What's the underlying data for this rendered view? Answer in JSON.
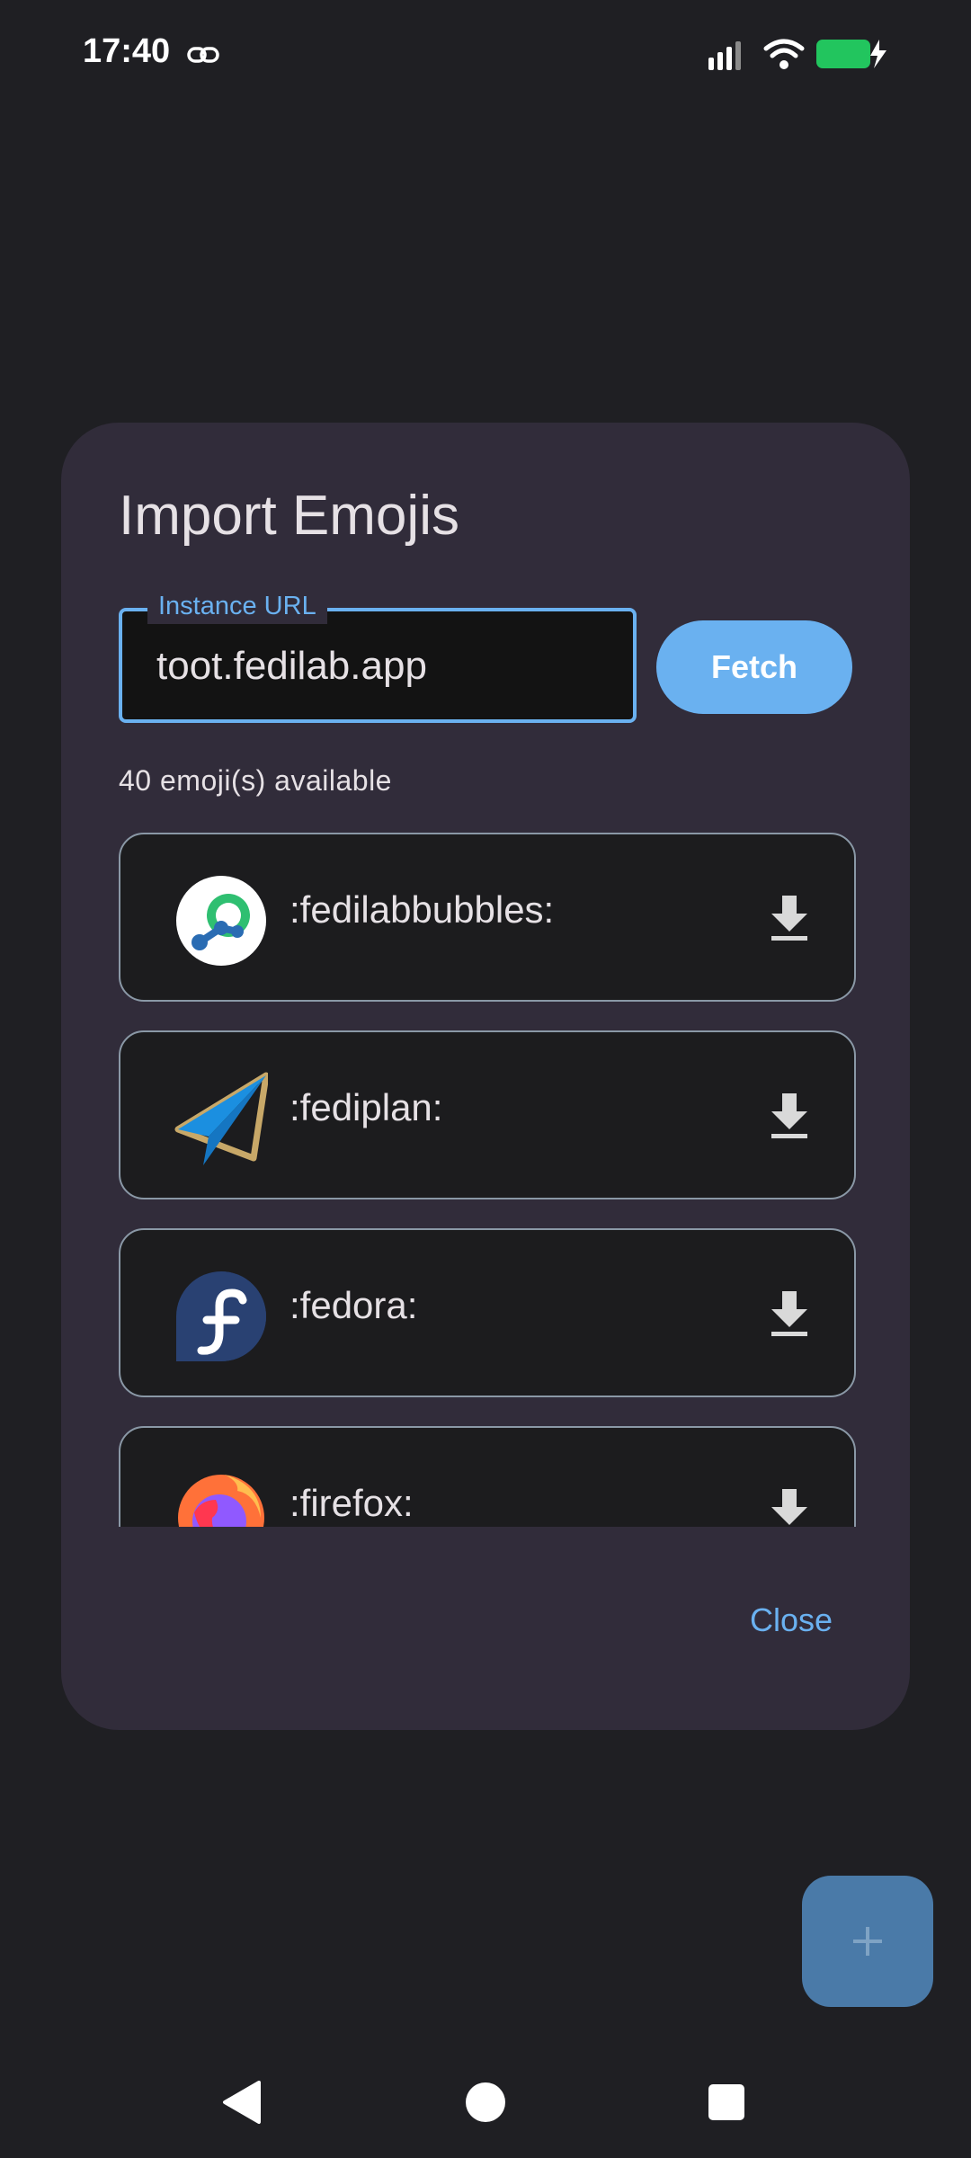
{
  "status_bar": {
    "time": "17:40",
    "icons": [
      "link-icon",
      "signal-icon",
      "wifi-icon",
      "battery-charging-icon"
    ],
    "battery_color": "#22c55e"
  },
  "dialog": {
    "title": "Import Emojis",
    "instance_url": {
      "label": "Instance URL",
      "value": "toot.fedilab.app"
    },
    "fetch_label": "Fetch",
    "available_count": "40 emoji(s) available",
    "emojis": [
      {
        "shortcode": ":fedilabbubbles:",
        "icon": "fedilab-icon"
      },
      {
        "shortcode": ":fediplan:",
        "icon": "paper-plane-icon"
      },
      {
        "shortcode": ":fedora:",
        "icon": "fedora-icon"
      },
      {
        "shortcode": ":firefox:",
        "icon": "firefox-icon"
      }
    ],
    "close_label": "Close"
  },
  "fab": {
    "icon": "plus-icon"
  },
  "nav_bar": {
    "icons": [
      "back-icon",
      "home-icon",
      "recents-icon"
    ]
  },
  "colors": {
    "accent": "#6ab1f0",
    "dialog_bg": "#312c3a",
    "screen_bg": "#1f1f23"
  }
}
